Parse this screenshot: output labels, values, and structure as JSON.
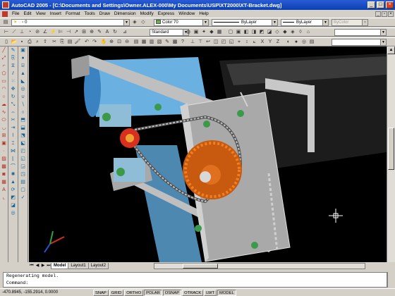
{
  "window": {
    "title": "AutoCAD 2005 - [C:\\Documents and Settings\\Owner.ALEX-000\\My Documents\\USP\\XT2000\\XT-Bracket.dwg]",
    "minimize": "_",
    "maximize": "□",
    "close": "×"
  },
  "menu": [
    "File",
    "Edit",
    "View",
    "Insert",
    "Format",
    "Tools",
    "Draw",
    "Dimension",
    "Modify",
    "Express",
    "Window",
    "Help"
  ],
  "toolbar": {
    "layer_value": "0",
    "color_value": "Color 70",
    "linetype_value": "ByLayer",
    "lineweight_value": "ByLayer",
    "plotstyle_value": "ByColor",
    "textstyle_value": "Standard",
    "color_swatch": "#6ab04c"
  },
  "tabs": {
    "model": "Model",
    "layout1": "Layout1",
    "layout2": "Layout2"
  },
  "command": {
    "line1": "Regenerating model.",
    "line2": "Command:"
  },
  "status": {
    "coords": "-470.8945, -155.2914, 0.0000",
    "buttons": [
      "SNAP",
      "GRID",
      "ORTHO",
      "POLAR",
      "OSNAP",
      "OTRACK",
      "LWT",
      "MODEL"
    ]
  },
  "colors": {
    "background": "#000000",
    "cylinder": "#6ab0e0",
    "frame": "#b8b8b8",
    "sprocket": "#d06a10",
    "chain": "#c0c0c0"
  },
  "icons": [
    "ucs-icon",
    "cursor-crosshair-icon"
  ]
}
